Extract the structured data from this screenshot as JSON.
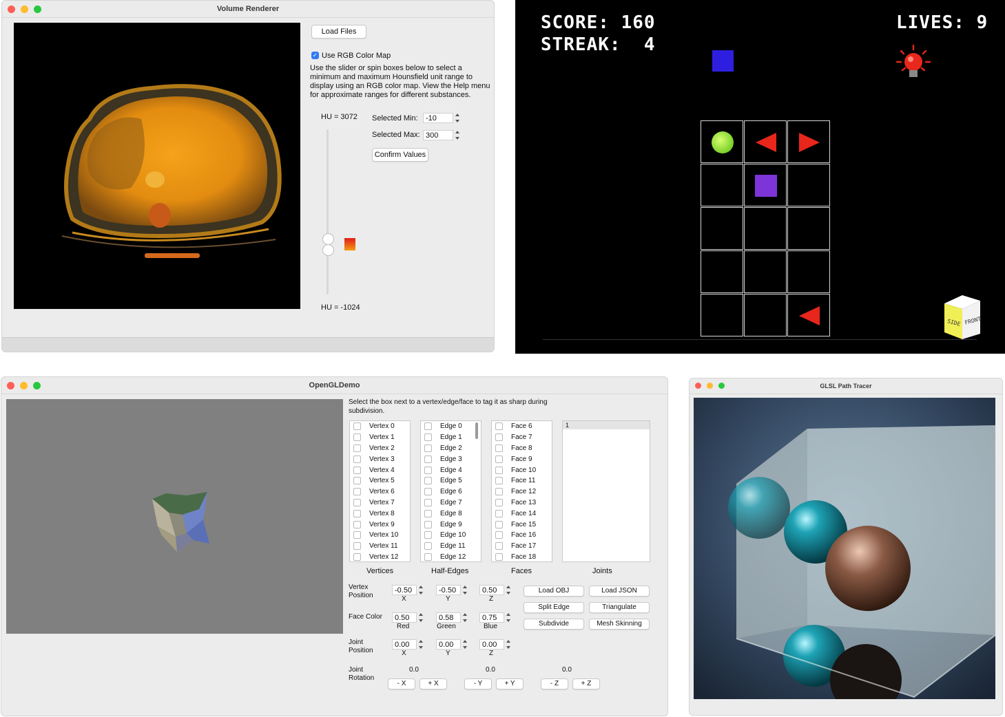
{
  "volume": {
    "title": "Volume Renderer",
    "load_files": "Load Files",
    "use_rgb": "Use RGB Color Map",
    "description": "Use the slider or spin boxes below to select a minimum and maximum Hounsfield unit range to display using an RGB color map. View the Help menu for approximate ranges for different substances.",
    "hu_max": "HU = 3072",
    "hu_min": "HU = -1024",
    "sel_min_label": "Selected Min:",
    "sel_min_value": "-10",
    "sel_max_label": "Selected Max:",
    "sel_max_value": "300",
    "confirm": "Confirm Values"
  },
  "game": {
    "score": "SCORE: 160",
    "streak": "STREAK:  4",
    "lives": "LIVES: 9",
    "cube_side": "SIDE",
    "cube_front": "FRONT"
  },
  "opengl": {
    "title": "OpenGLDemo",
    "instructions": "Select the box next to a vertex/edge/face to tag it as sharp during subdivision.",
    "vertices": [
      "Vertex 0",
      "Vertex 1",
      "Vertex 2",
      "Vertex 3",
      "Vertex 4",
      "Vertex 5",
      "Vertex 6",
      "Vertex 7",
      "Vertex 8",
      "Vertex 9",
      "Vertex 10",
      "Vertex 11",
      "Vertex 12"
    ],
    "edges": [
      "Edge 0",
      "Edge 1",
      "Edge 2",
      "Edge 3",
      "Edge 4",
      "Edge 5",
      "Edge 6",
      "Edge 7",
      "Edge 8",
      "Edge 9",
      "Edge 10",
      "Edge 11",
      "Edge 12"
    ],
    "faces": [
      "Face 6",
      "Face 7",
      "Face 8",
      "Face 9",
      "Face 10",
      "Face 11",
      "Face 12",
      "Face 13",
      "Face 14",
      "Face 15",
      "Face 16",
      "Face 17",
      "Face 18"
    ],
    "joints": [
      "1"
    ],
    "headers": {
      "vertices": "Vertices",
      "half_edges": "Half-Edges",
      "faces": "Faces",
      "joints": "Joints"
    },
    "vertex_position": {
      "label": "Vertex Position",
      "x": "-0.50",
      "y": "-0.50",
      "z": "0.50",
      "xl": "X",
      "yl": "Y",
      "zl": "Z"
    },
    "face_color": {
      "label": "Face Color",
      "r": "0.50",
      "g": "0.58",
      "b": "0.75",
      "rl": "Red",
      "gl": "Green",
      "bl": "Blue"
    },
    "joint_position": {
      "label": "Joint Position",
      "x": "0.00",
      "y": "0.00",
      "z": "0.00",
      "xl": "X",
      "yl": "Y",
      "zl": "Z"
    },
    "joint_rotation": {
      "label": "Joint Rotation",
      "x": "0.0",
      "y": "0.0",
      "z": "0.0"
    },
    "rot_buttons": [
      "- X",
      "+ X",
      "- Y",
      "+ Y",
      "- Z",
      "+ Z"
    ],
    "buttons": {
      "load_obj": "Load OBJ",
      "load_json": "Load JSON",
      "split_edge": "Split Edge",
      "triangulate": "Triangulate",
      "subdivide": "Subdivide",
      "mesh_skinning": "Mesh Skinning"
    }
  },
  "pathtracer": {
    "title": "GLSL Path Tracer"
  },
  "colors": {
    "game_bg": "#000000",
    "viewport_gray": "#808080",
    "accent_blue": "#2f7bf5"
  }
}
